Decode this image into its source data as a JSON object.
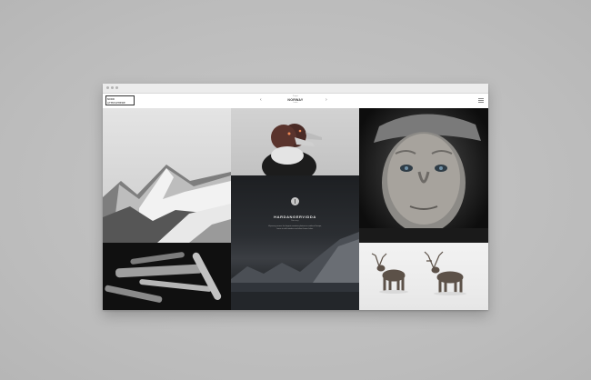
{
  "header": {
    "logo_line1": "NORR",
    "logo_line2": "ATMOSPHERE",
    "prev_arrow": "‹",
    "next_arrow": "›",
    "project_small": "Project",
    "project_title": "NORWAY",
    "project_sub": "Index"
  },
  "tiles": [
    {
      "name": "snowy-mountains-photo"
    },
    {
      "name": "ducks-photo"
    },
    {
      "name": "old-man-portrait-photo"
    },
    {
      "name": "hardangervidda-landscape-photo"
    },
    {
      "name": "driftwood-sticks-photo"
    },
    {
      "name": "reindeer-photo"
    }
  ],
  "caption": {
    "icon": "info-icon",
    "title": "HARDANGERVIDDA",
    "subtitle": "Norway",
    "text": "A journey across the largest mountain plateau in northern Europe, home to wild reindeer and silent frozen lakes."
  },
  "colors": {
    "background": "#bfbfbf",
    "browser_bg": "#ffffff",
    "chrome_bar": "#ececec",
    "dark_tile": "#1d1f22"
  }
}
